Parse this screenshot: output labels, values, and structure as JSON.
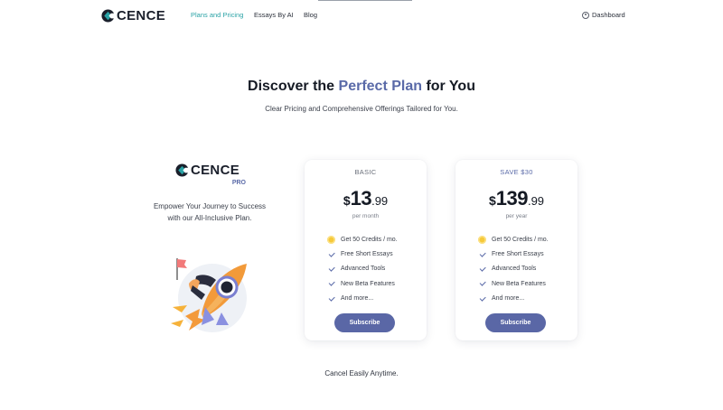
{
  "brand": {
    "name": "CENCE",
    "pro_tag": "PRO",
    "accent": "#5a6aa8",
    "teal": "#2aa3a6"
  },
  "nav": {
    "links": [
      {
        "label": "Plans and Pricing",
        "active": true
      },
      {
        "label": "Essays By AI",
        "active": false
      },
      {
        "label": "Blog",
        "active": false
      }
    ],
    "dashboard_label": "Dashboard"
  },
  "hero": {
    "title_pre": "Discover the ",
    "title_accent": "Perfect Plan",
    "title_post": " for You",
    "subtitle": "Clear Pricing and Comprehensive Offerings Tailored for You."
  },
  "promo": {
    "line1": "Empower Your Journey to Success",
    "line2": "with our All-Inclusive Plan."
  },
  "plans": [
    {
      "label": "BASIC",
      "currency": "$",
      "amount": "13",
      "cents": ".99",
      "period": "per month",
      "features": [
        "Get 50 Credits / mo.",
        "Free Short Essays",
        "Advanced Tools",
        "New Beta Features",
        "And more..."
      ],
      "button": "Subscribe"
    },
    {
      "label": "SAVE $30",
      "currency": "$",
      "amount": "139",
      "cents": ".99",
      "period": "per year",
      "features": [
        "Get 50 Credits / mo.",
        "Free Short Essays",
        "Advanced Tools",
        "New Beta Features",
        "And more..."
      ],
      "button": "Subscribe"
    }
  ],
  "footer_note": "Cancel Easily Anytime."
}
